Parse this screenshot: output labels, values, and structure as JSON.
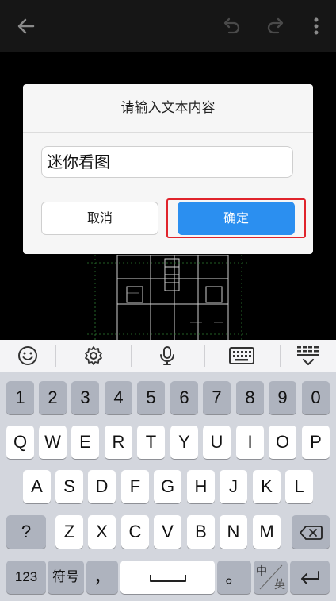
{
  "app_bar": {
    "back_icon": "arrow-left-icon",
    "undo_icon": "undo-icon",
    "redo_icon": "redo-icon",
    "more_icon": "more-vertical-icon"
  },
  "dialog": {
    "title": "请输入文本内容",
    "input_value": "迷你看图",
    "cancel_label": "取消",
    "confirm_label": "确定",
    "confirm_color": "#2b8ff0",
    "highlight_color": "#e0242c"
  },
  "keyboard": {
    "toolbar": [
      "emoji-icon",
      "gear-icon",
      "microphone-icon",
      "keyboard-icon",
      "collapse-keyboard-icon"
    ],
    "row_numbers": [
      "1",
      "2",
      "3",
      "4",
      "5",
      "6",
      "7",
      "8",
      "9",
      "0"
    ],
    "row_top": [
      "Q",
      "W",
      "E",
      "R",
      "T",
      "Y",
      "U",
      "I",
      "O",
      "P"
    ],
    "row_mid": [
      "A",
      "S",
      "D",
      "F",
      "G",
      "H",
      "J",
      "K",
      "L"
    ],
    "row_bottom": [
      "Z",
      "X",
      "C",
      "V",
      "B",
      "N",
      "M"
    ],
    "question_key": "?",
    "numbers_key": "123",
    "symbols_key": "符号",
    "comma_key": "，",
    "period_key": "。",
    "lang_key_top": "中",
    "lang_key_bottom": "英",
    "backspace_icon": "backspace-icon",
    "space_icon": "space-bar-icon",
    "enter_icon": "enter-icon"
  }
}
